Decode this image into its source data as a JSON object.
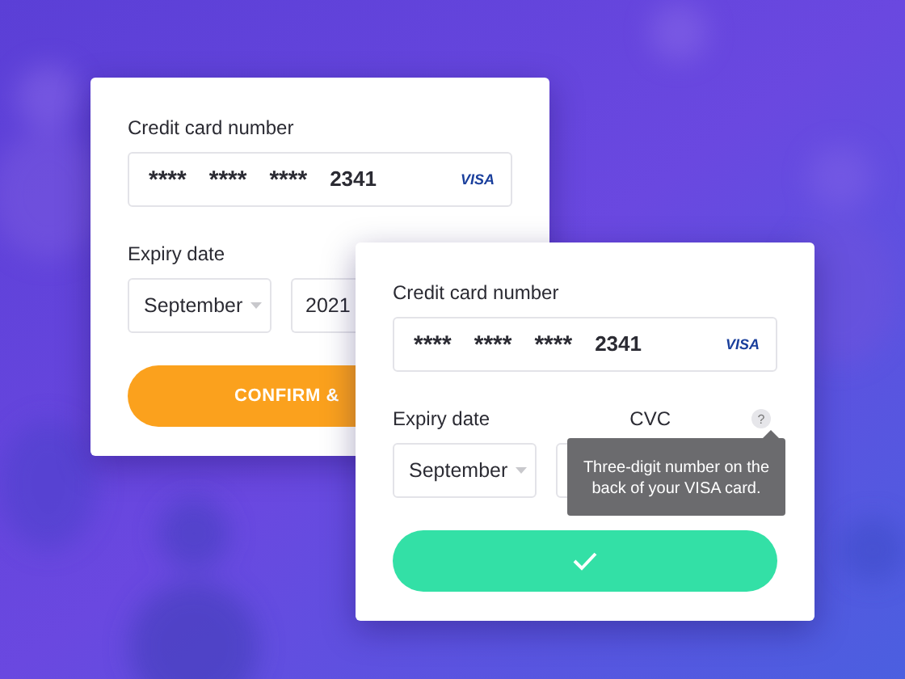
{
  "cards": [
    {
      "card_label": "Credit card number",
      "card_digits": [
        "****",
        "****",
        "****",
        "2341"
      ],
      "card_brand": "VISA",
      "expiry_label": "Expiry date",
      "month": "September",
      "year": "2021",
      "button": {
        "kind": "text",
        "label": "CONFIRM &"
      }
    },
    {
      "card_label": "Credit card number",
      "card_digits": [
        "****",
        "****",
        "****",
        "2341"
      ],
      "card_brand": "VISA",
      "expiry_label": "Expiry date",
      "cvc_label": "CVC",
      "help": "?",
      "month": "September",
      "tooltip": "Three-digit number on the back of your VISA card.",
      "button": {
        "kind": "check"
      }
    }
  ]
}
